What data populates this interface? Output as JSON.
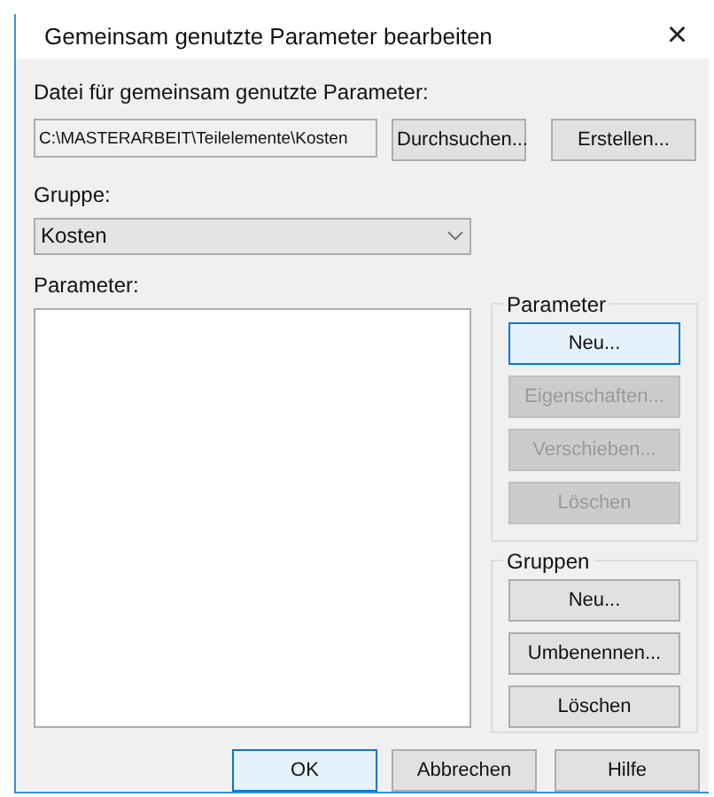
{
  "window": {
    "title": "Gemeinsam genutzte Parameter bearbeiten",
    "close": "×"
  },
  "file": {
    "label": "Datei für gemeinsam genutzte Parameter:",
    "value": "C:\\MASTERARBEIT\\Teilelemente\\Kosten",
    "buttons": [
      {
        "label": "Durchsuchen...",
        "kind": "normal"
      },
      {
        "label": "Erstellen...",
        "kind": "normal"
      }
    ]
  },
  "group_select": {
    "label": "Gruppe:",
    "value": "Kosten"
  },
  "parameters_list": {
    "label": "Parameter:"
  },
  "parameter_box": {
    "title": "Parameter",
    "buttons": [
      {
        "label": "Neu...",
        "kind": "default"
      },
      {
        "label": "Eigenschaften...",
        "kind": "disabled"
      },
      {
        "label": "Verschieben...",
        "kind": "disabled"
      },
      {
        "label": "Löschen",
        "kind": "disabled"
      }
    ]
  },
  "groups_box": {
    "title": "Gruppen",
    "buttons": [
      {
        "label": "Neu...",
        "kind": "normal"
      },
      {
        "label": "Umbenennen...",
        "kind": "normal"
      },
      {
        "label": "Löschen",
        "kind": "normal"
      }
    ]
  },
  "footer_buttons": [
    {
      "label": "OK",
      "kind": "default"
    },
    {
      "label": "Abbrechen",
      "kind": "normal"
    },
    {
      "label": "Hilfe",
      "kind": "normal"
    }
  ]
}
